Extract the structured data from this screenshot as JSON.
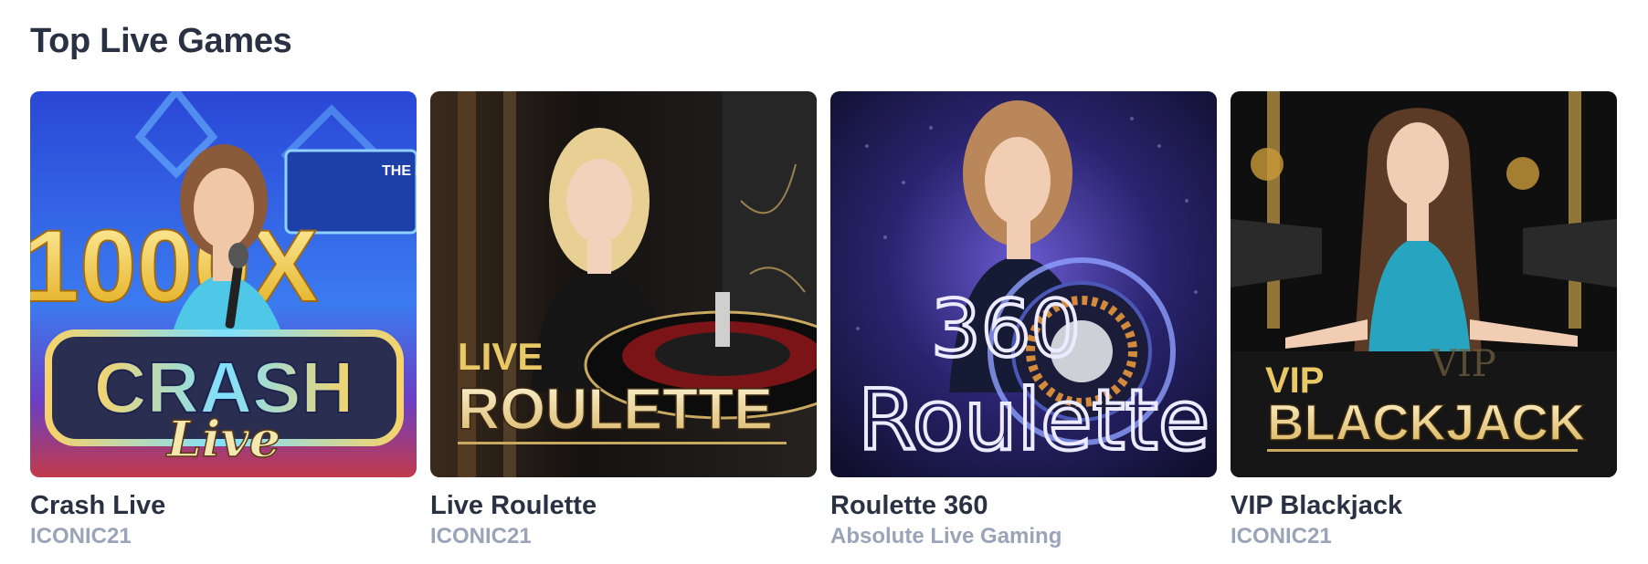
{
  "section": {
    "title": "Top Live Games"
  },
  "games": [
    {
      "name": "Crash Live",
      "provider": "ICONIC21",
      "thumb_text": {
        "big": "1000X",
        "main": "CRASH",
        "script": "Live",
        "badge": "THE E"
      }
    },
    {
      "name": "Live Roulette",
      "provider": "ICONIC21",
      "thumb_text": {
        "small": "LIVE",
        "main": "ROULETTE"
      }
    },
    {
      "name": "Roulette 360",
      "provider": "Absolute Live Gaming",
      "thumb_text": {
        "top": "360",
        "main": "Roulette"
      }
    },
    {
      "name": "VIP Blackjack",
      "provider": "ICONIC21",
      "thumb_text": {
        "small": "VIP",
        "main": "BLACKJACK",
        "table": "VIP"
      }
    }
  ],
  "colors": {
    "title": "#2a3142",
    "provider": "#9aa4b8",
    "crash_bg": "#2d4fd8",
    "roulette_bg": "#1a1614",
    "r360_bg": "#2a2a6a",
    "blackjack_bg": "#111111",
    "gold": "#e9c866"
  },
  "icons": [
    "dealer-figure",
    "roulette-wheel",
    "microphone"
  ]
}
